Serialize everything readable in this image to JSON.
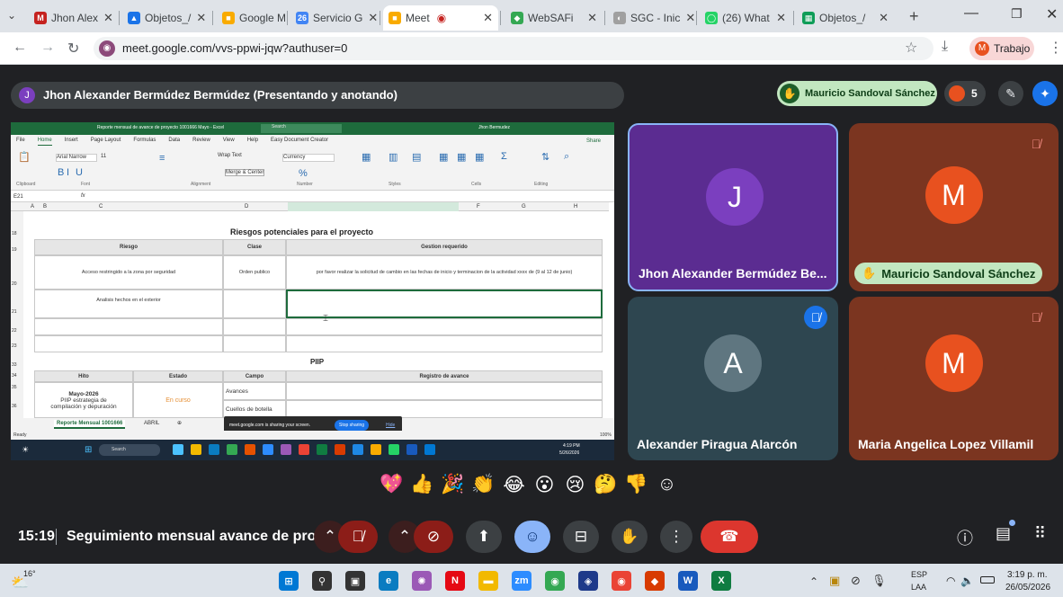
{
  "browser": {
    "tabs": [
      {
        "label": "Jhon Alex",
        "icon": "gmail-icon",
        "color": "#c5221f",
        "glyph": "M"
      },
      {
        "label": "Objetos_/",
        "icon": "drive-icon",
        "color": "#1a73e8",
        "glyph": "▲"
      },
      {
        "label": "Google M",
        "icon": "slides-icon",
        "color": "#f9ab00",
        "glyph": "■"
      },
      {
        "label": "Servicio G",
        "icon": "calendar-icon",
        "color": "#4285f4",
        "glyph": "26"
      },
      {
        "label": "Meet",
        "icon": "meet-icon",
        "color": "#f9ab00",
        "glyph": "■",
        "active": true
      },
      {
        "label": "WebSAFi",
        "icon": "websafi-icon",
        "color": "#34a853",
        "glyph": "◆"
      },
      {
        "label": "SGC - Inic",
        "icon": "sgc-icon",
        "color": "#a0a0a0",
        "glyph": "◐"
      },
      {
        "label": "(26) What",
        "icon": "whatsapp-icon",
        "color": "#25d366",
        "glyph": "◯"
      },
      {
        "label": "Objetos_/",
        "icon": "sheets-icon",
        "color": "#0f9d58",
        "glyph": "▦"
      }
    ],
    "new_tab": "+",
    "url": "meet.google.com/vvs-ppwi-jqw?authuser=0",
    "profile_label": "Trabajo",
    "profile_initial": "M"
  },
  "meet": {
    "presenter_initial": "J",
    "presenter_title": "Jhon Alexander Bermúdez Bermúdez (Presentando y anotando)",
    "hand_raised_name": "Mauricio Sandoval Sánchez",
    "participant_count": "5",
    "tiles": [
      {
        "initial": "J",
        "name": "Jhon Alexander Bermúdez Be...",
        "avatar_color": "#7b3fbf",
        "bg": "#5b2c91",
        "muted": false
      },
      {
        "initial": "M",
        "name": "Mauricio Sandoval Sánchez",
        "avatar_color": "#e8511f",
        "bg": "#7b3520",
        "muted": true,
        "hand": true
      },
      {
        "initial": "A",
        "name": "Alexander Piragua Alarcón",
        "avatar_color": "#5f7680",
        "bg": "#2e4650",
        "muted": true
      },
      {
        "initial": "M",
        "name": "Maria Angelica Lopez Villamil",
        "avatar_color": "#e8511f",
        "bg": "#7b3520",
        "muted": true
      }
    ],
    "reactions": [
      "💖",
      "👍",
      "🎉",
      "👏",
      "😂",
      "😮",
      "😢",
      "🤔",
      "👎",
      "☺"
    ],
    "time": "15:19",
    "meeting_title": "Seguimiento mensual avance de pro..."
  },
  "excel": {
    "title": "Reporte mensual de avance de proyecto 1001666 Mayo - Excel",
    "search": "Search",
    "user": "Jhon Bermudez",
    "menu": [
      "File",
      "Home",
      "Insert",
      "Page Layout",
      "Formulas",
      "Data",
      "Review",
      "View",
      "Help",
      "Easy Document Creator"
    ],
    "share": "Share",
    "font": "Arial Narrow",
    "font_size": "11",
    "wrap": "Wrap Text",
    "merge": "Merge & Center",
    "number_format": "Currency",
    "groups": [
      "Clipboard",
      "Font",
      "Alignment",
      "Number",
      "Styles",
      "Cells",
      "Editing"
    ],
    "cell_ref": "E21",
    "columns": [
      "A",
      "B",
      "C",
      "D",
      "E",
      "F",
      "G",
      "H"
    ],
    "section1_title": "Riesgos potenciales para el proyecto",
    "risk_headers": [
      "Riesgo",
      "Clase",
      "Gestion requerido"
    ],
    "risk_rows": [
      {
        "riesgo": "Acceso restringido a la zona por seguridad",
        "clase": "Orden publico",
        "gestion": "por favor realizar la solicitud de cambio en las fechas de inicio y terminacion de la actividad xxxx de (9 al 12 de junio)"
      },
      {
        "riesgo": "Analisis hechos en el exterior",
        "clase": "",
        "gestion": ""
      }
    ],
    "section2_title": "PIIP",
    "piip_headers": [
      "Hito",
      "Estado",
      "Campo",
      "Registro de avance"
    ],
    "piip_hito_1": "Mayo-2026",
    "piip_hito_2": "PIIP estrategia de",
    "piip_hito_3": "compilación y depuración",
    "piip_estado": "En curso",
    "piip_campos": [
      "Avances",
      "Cuellos de botella"
    ],
    "row_numbers": [
      "18",
      "19",
      "20",
      "21",
      "22",
      "23",
      "33",
      "34",
      "35",
      "36"
    ],
    "sheet_tab": "Reporte Mensual 1001666",
    "sheet_tab2": "ABRIL",
    "status": "Ready",
    "sharing_msg": "meet.google.com is sharing your screen.",
    "stop_sharing": "Stop sharing",
    "hide": "Hide",
    "zoom": "100%",
    "inner_search": "Search",
    "inner_time": "4:19 PM",
    "inner_date": "5/26/2026"
  },
  "taskbar": {
    "temperature": "16°",
    "lang1": "ESP",
    "lang2": "LAA",
    "time": "3:19 p. m.",
    "date": "26/05/2026"
  }
}
